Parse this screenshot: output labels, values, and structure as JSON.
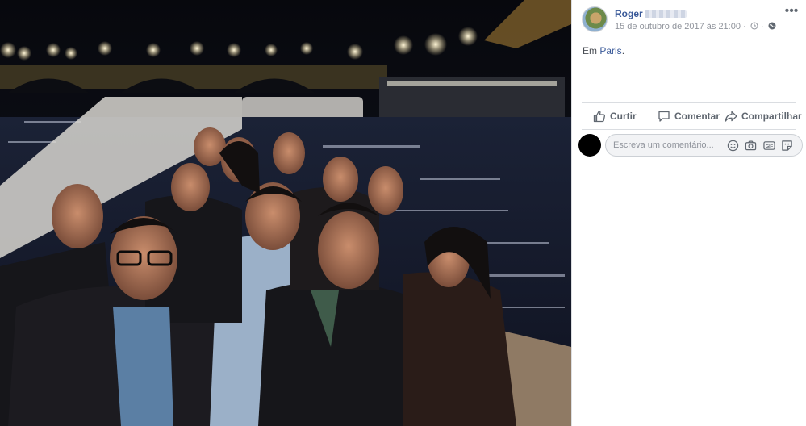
{
  "photo": {
    "description_icon": "group-selfie-photo"
  },
  "post": {
    "author_first_name": "Roger",
    "timestamp": "15 de outubro de 2017 às 21:00 · ",
    "text_prefix": "Em ",
    "place_link": "Paris",
    "text_suffix": ".",
    "more_label": "•••"
  },
  "actions": {
    "like_label": "Curtir",
    "comment_label": "Comentar",
    "share_label": "Compartilhar"
  },
  "comment_input": {
    "placeholder": "Escreva um comentário..."
  },
  "icons": {
    "like": "thumbs-up-icon",
    "comment": "speech-bubble-icon",
    "share": "share-arrow-icon",
    "emoji": "smiley-icon",
    "camera": "camera-icon",
    "gif": "gif-icon",
    "sticker": "sticker-icon",
    "edited": "clock-icon",
    "privacy": "globe-icon"
  },
  "colors": {
    "link": "#385898",
    "secondary_text": "#90949c",
    "action_text": "#606770"
  }
}
